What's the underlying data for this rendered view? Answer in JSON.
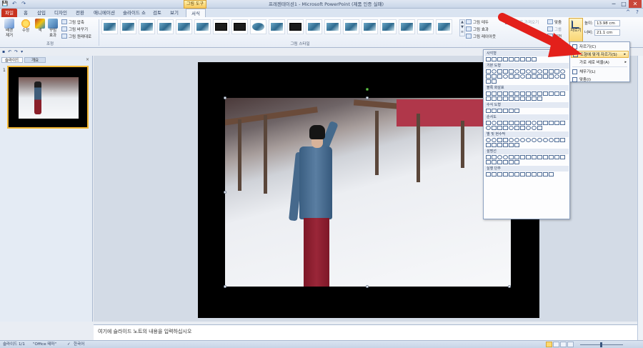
{
  "window": {
    "title": "프레젠테이션1 - Microsoft PowerPoint (제품 인증 실패)",
    "context_tab": "그림 도구",
    "controls": [
      "─",
      "□",
      "✕"
    ]
  },
  "qat": [
    "💾",
    "↶",
    "↷"
  ],
  "tabs": [
    {
      "label": "파일"
    },
    {
      "label": "홈"
    },
    {
      "label": "삽입"
    },
    {
      "label": "디자인"
    },
    {
      "label": "전환"
    },
    {
      "label": "애니메이션"
    },
    {
      "label": "슬라이드 쇼"
    },
    {
      "label": "검토"
    },
    {
      "label": "보기"
    },
    {
      "label": "서식"
    }
  ],
  "ribbon": {
    "adjust": {
      "remove_bg": "배경\n제거",
      "correct": "수정",
      "color": "색",
      "artistic": "꾸밈\n효과",
      "compress": "그림 압축",
      "change": "그림 바꾸기",
      "reset": "그림 원래대로",
      "group_label": "조정"
    },
    "styles": {
      "group_label": "그림 스타일",
      "border": "그림 테두",
      "effects": "그림 효과",
      "layout": "그림 레이아웃",
      "bring_forward": "앞으로 가져오기",
      "align": "맞춤",
      "group": "그룹",
      "rotate": "회전"
    },
    "size": {
      "crop_label": "자르기",
      "height_label": "높이:",
      "height_value": "13.98 cm",
      "width_label": "너비:",
      "width_value": "21.1 cm"
    }
  },
  "crop_menu": {
    "items": [
      {
        "label": "자르기(C)"
      },
      {
        "label": "도형에 맞게 자르기(S)"
      },
      {
        "label": "가로 세로 비율(A)"
      },
      {
        "label": "채우기(L)"
      },
      {
        "label": "맞춤(I)"
      }
    ]
  },
  "shape_menu": {
    "sections": [
      "사각형",
      "기본 도형",
      "블록 화살표",
      "수식 도형",
      "순서도",
      "별 및 현수막",
      "설명선",
      "실행 단추"
    ]
  },
  "panel": {
    "tabs": [
      "슬라이드",
      "개요"
    ],
    "close": "×",
    "slide_number": "1"
  },
  "notes": {
    "placeholder": "여기에 슬라이드 노트의 내용을 입력하십시오"
  },
  "status": {
    "slide": "슬라이드 1/1",
    "theme": "\"Office 테마\"",
    "language": "한국어"
  },
  "colors": {
    "file_tab": "#c8321f",
    "accent_highlight": "#fbdc8a",
    "annotation_arrow": "#e3201b"
  }
}
